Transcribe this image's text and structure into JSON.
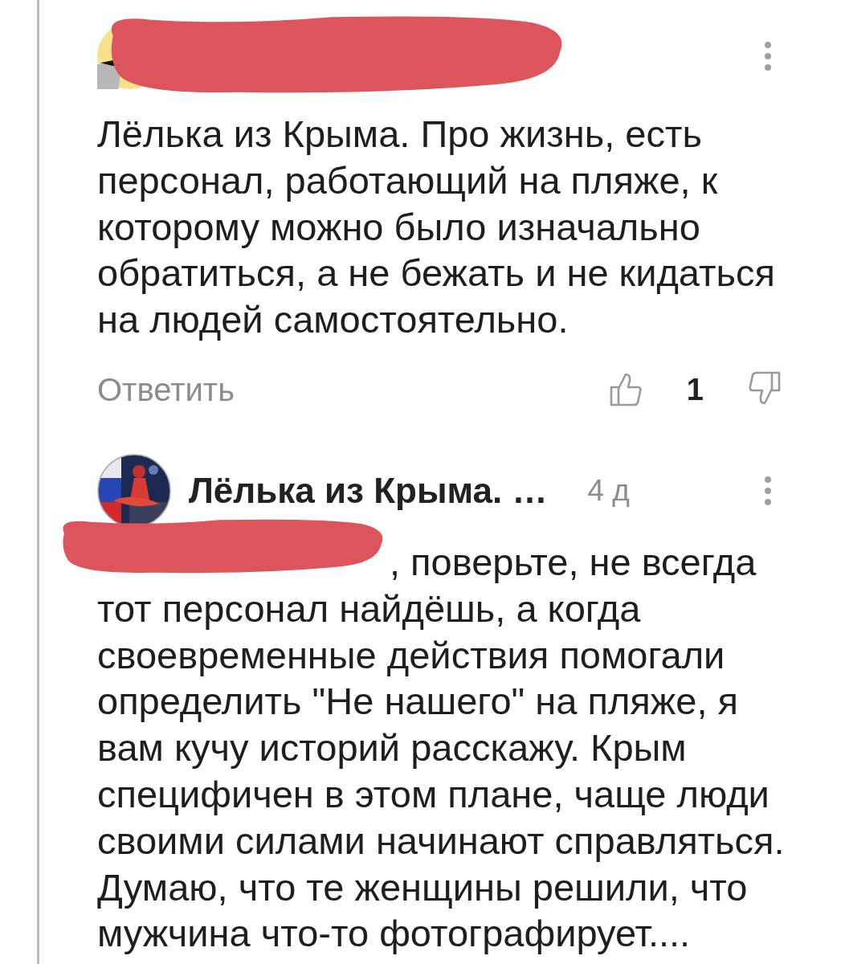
{
  "comments": [
    {
      "header_covered": true,
      "text_covered": false,
      "text": "Лёлька из Крыма. Про жизнь, есть персонал, работающий на пляже, к которому можно было изначально обратиться, а не бежать и не кидаться на людей самостоятельно.",
      "reply_label": "Ответить",
      "likes": "1"
    },
    {
      "author": "Лёлька из Крыма. …",
      "time": "4 д",
      "header_covered": false,
      "text_covered": true,
      "text": ", поверьте, не всегда тот персонал найдёшь, а когда своевременные действия помогали определить \"Не нашего\" на пляже, я вам кучу историй расскажу. Крым специфичен в этом плане, чаще люди своими силами начинают справляться. Думаю, что те женщины решили, что мужчина что-то фотографирует...."
    }
  ]
}
